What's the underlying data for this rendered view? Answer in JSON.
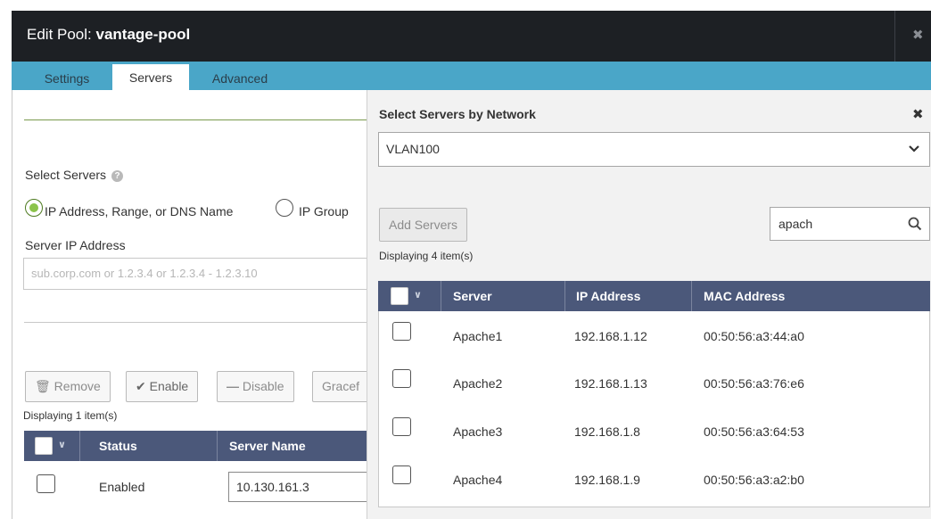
{
  "dialog": {
    "title_prefix": "Edit Pool: ",
    "title_name": "vantage-pool",
    "close_glyph": "✖"
  },
  "tabs": [
    {
      "label": "Settings",
      "active": false
    },
    {
      "label": "Servers",
      "active": true
    },
    {
      "label": "Advanced",
      "active": false
    }
  ],
  "left": {
    "select_servers_label": "Select Servers",
    "help_glyph": "?",
    "radio_ip_label": "IP Address, Range, or DNS Name",
    "radio_group_label": "IP Group",
    "server_ip_label": "Server IP Address",
    "server_ip_placeholder": "sub.corp.com or 1.2.3.4 or 1.2.3.4 - 1.2.3.10",
    "buttons": {
      "remove": "Remove",
      "enable": "Enable",
      "disable": "Disable",
      "graceful": "Gracef"
    },
    "displaying": "Displaying 1 item(s)",
    "table": {
      "columns": [
        "Status",
        "Server Name"
      ],
      "rows": [
        {
          "status": "Enabled",
          "server_name": "10.130.161.3"
        }
      ]
    }
  },
  "right": {
    "heading": "Select Servers by Network",
    "close_glyph": "✖",
    "network_select": "VLAN100",
    "add_servers": "Add Servers",
    "search_value": "apach",
    "displaying": "Displaying 4 item(s)",
    "table": {
      "columns": [
        "Server",
        "IP Address",
        "MAC Address"
      ],
      "rows": [
        {
          "server": "Apache1",
          "ip": "192.168.1.12",
          "mac": "00:50:56:a3:44:a0"
        },
        {
          "server": "Apache2",
          "ip": "192.168.1.13",
          "mac": "00:50:56:a3:76:e6"
        },
        {
          "server": "Apache3",
          "ip": "192.168.1.8",
          "mac": "00:50:56:a3:64:53"
        },
        {
          "server": "Apache4",
          "ip": "192.168.1.9",
          "mac": "00:50:56:a3:a2:b0"
        }
      ]
    }
  },
  "icons": {
    "trash": "🗑",
    "check": "✔",
    "minus": "—",
    "chevron_down": "⌄",
    "small_chevron": "∨"
  }
}
